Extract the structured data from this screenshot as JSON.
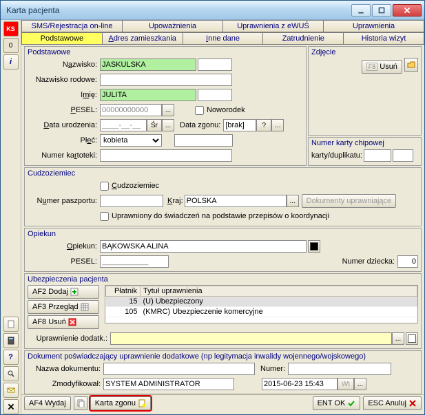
{
  "window": {
    "title": "Karta pacjenta"
  },
  "top_tabs": {
    "sms": "SMS/Rejestracja on-line",
    "upowaznienia": "Upoważnienia",
    "uprawnienia_ewus": "Uprawnienia z eWUŚ",
    "uprawnienia": "Uprawnienia"
  },
  "sub_tabs": {
    "podstawowe": "Podstawowe",
    "adres": "Adres zamieszkania",
    "inne": "Inne dane",
    "zatrudnienie": "Zatrudnienie",
    "historia": "Historia wizyt"
  },
  "podstawowe": {
    "section": "Podstawowe",
    "nazwisko_lbl": "Nazwisko:",
    "nazwisko": "JASKULSKA",
    "nazwisko_rodowe_lbl": "Nazwisko rodowe:",
    "nazwisko_rodowe": "",
    "imie_lbl": "Imię:",
    "imie": "JULITA",
    "pesel_lbl": "PESEL:",
    "pesel": "00000000000",
    "noworodek_lbl": "Noworodek",
    "data_ur_lbl": "Data urodzenia:",
    "data_ur": "____-__-__",
    "sr_lbl": "Śr",
    "data_zgonu_lbl": "Data zgonu:",
    "data_zgonu": "[brak]",
    "q": "?",
    "plec_lbl": "Płeć:",
    "plec": "kobieta",
    "numer_kartoteki_lbl": "Numer kartoteki:",
    "numer_kartoteki": ""
  },
  "zdjecie": {
    "section": "Zdjęcie",
    "usun_btn": "F8 Usuń"
  },
  "chip": {
    "section": "Numer karty chipowej",
    "karty_lbl": "karty/duplikatu:",
    "karty": "",
    "dup": ""
  },
  "cudzoziemiec": {
    "section": "Cudzoziemiec",
    "chk_lbl": "Cudzoziemiec",
    "paszport_lbl": "Numer paszportu:",
    "paszport": "",
    "kraj_lbl": "Kraj:",
    "kraj": "POLSKA",
    "dok_btn": "Dokumenty uprawniające",
    "koord_lbl": "Uprawniony do świadczeń na podstawie przepisów o koordynacji"
  },
  "opiekun": {
    "section": "Opiekun",
    "opiekun_lbl": "Opiekun:",
    "opiekun": "BĄKOWSKA ALINA",
    "pesel_lbl": "PESEL:",
    "pesel": "___________",
    "numer_dziecka_lbl": "Numer dziecka:",
    "numer_dziecka": "0"
  },
  "ubezp": {
    "section": "Ubezpieczenia pacjenta",
    "dodaj": "AF2 Dodaj",
    "przeglad": "AF3 Przegląd",
    "usun": "AF8 Usuń",
    "col_platnik": "Płatnik",
    "col_tytul": "Tytuł uprawnienia",
    "rows": [
      {
        "platnik": "15",
        "tytul": "(U) Ubezpieczony"
      },
      {
        "platnik": "105",
        "tytul": "(KMRC) Ubezpieczenie komercyjne"
      }
    ],
    "dodatk_lbl": "Uprawnienie dodatk.:",
    "dodatk": ""
  },
  "dokument": {
    "section": "Dokument poświadczający uprawnienie dodatkowe (np legitymacja inwalidy wojennego/wojskowego)",
    "nazwa_lbl": "Nazwa dokumentu:",
    "nazwa": "",
    "numer_lbl": "Numer:",
    "numer": "",
    "zmod_lbl": "Zmodyfikował:",
    "zmod": "SYSTEM ADMINISTRATOR",
    "zmod_data": "2015-06-23 15:43",
    "wt": "Wt"
  },
  "footer": {
    "wydaj": "AF4 Wydaj",
    "karta_zgonu": "Karta zgonu",
    "ok": "ENT OK",
    "anuluj": "ESC Anuluj"
  },
  "rail": {
    "ks": "KS",
    "zero": "0",
    "i": "i",
    "q": "?"
  }
}
